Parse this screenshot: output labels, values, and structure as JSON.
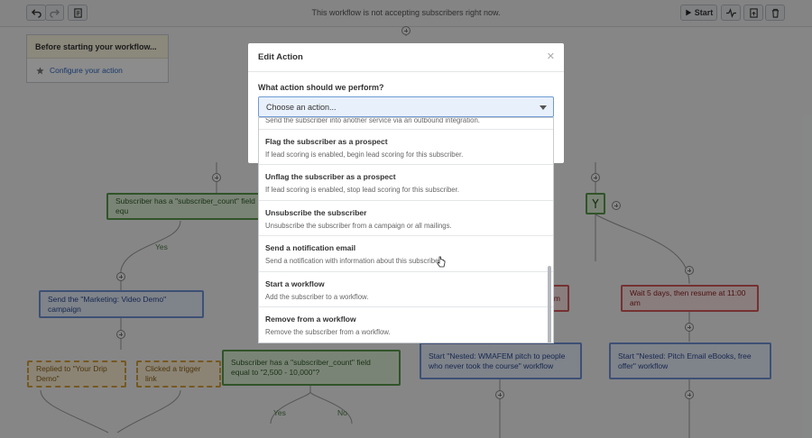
{
  "toolbar": {
    "message": "This workflow is not accepting subscribers right now.",
    "start_label": "Start",
    "buttons": [
      "undo-icon",
      "redo-icon",
      "notes-icon",
      "activity-icon",
      "export-icon",
      "trash-icon"
    ]
  },
  "sidebar_card": {
    "title": "Before starting your workflow...",
    "link": "Configure your action"
  },
  "nodes": {
    "cond_top": "Subscriber has a \"subscriber_count\" field equ",
    "yes1": "Yes",
    "act_demo": "Send the \"Marketing: Video Demo\" campaign",
    "trig_replied": "Replied to \"Your Drip Demo\"",
    "trig_clicked": "Clicked a trigger link",
    "cond_bottom": "Subscriber has a \"subscriber_count\" field equal to \"2,500 - 10,000\"?",
    "yes2": "Yes",
    "no2": "No",
    "wait_cut": "m",
    "wait_right": "Wait 5 days, then resume at 11:00 am",
    "nested1": "Start \"Nested: WMAFEM pitch to people who never took the course\" workflow",
    "nested2": "Start \"Nested: Pitch Email eBooks, free offer\" workflow"
  },
  "modal": {
    "title": "Edit Action",
    "question": "What action should we perform?",
    "select_value": "Choose an action...",
    "options": [
      {
        "title": "",
        "desc": "Send the subscriber into another service via an outbound integration."
      },
      {
        "title": "Flag the subscriber as a prospect",
        "desc": "If lead scoring is enabled, begin lead scoring for this subscriber."
      },
      {
        "title": "Unflag the subscriber as a prospect",
        "desc": "If lead scoring is enabled, stop lead scoring for this subscriber."
      },
      {
        "title": "Unsubscribe the subscriber",
        "desc": "Unsubscribe the subscriber from a campaign or all mailings."
      },
      {
        "title": "Send a notification email",
        "desc": "Send a notification with information about this subscriber."
      },
      {
        "title": "Start a workflow",
        "desc": "Add the subscriber to a workflow."
      },
      {
        "title": "Remove from a workflow",
        "desc": "Remove the subscriber from a workflow."
      }
    ]
  },
  "colors": {
    "condition": "#dff0d8",
    "action": "#e7eefb",
    "wait": "#fbe3e3",
    "trigger": "#fdf1d6"
  }
}
